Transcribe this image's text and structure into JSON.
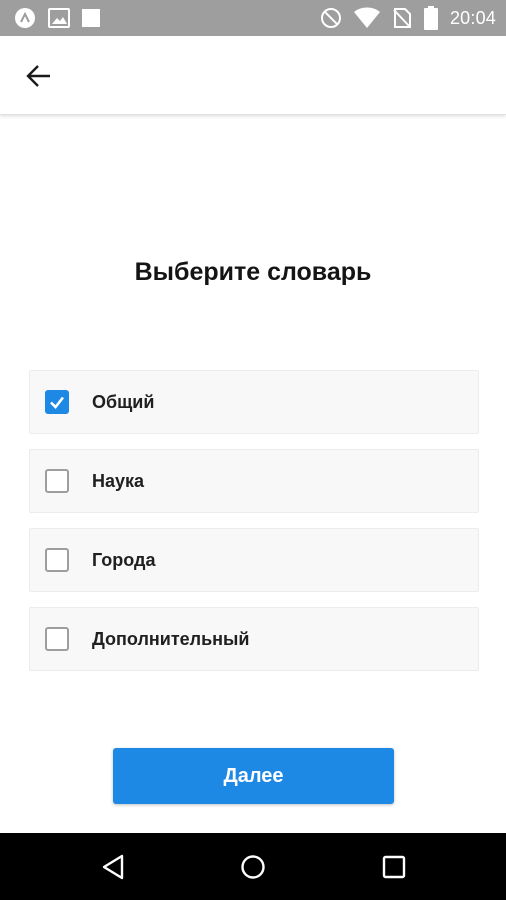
{
  "status_bar": {
    "time": "20:04",
    "left_icons": [
      "app-notification-icon",
      "image-notification-icon",
      "square-notification-icon"
    ],
    "right_icons": [
      "do-not-disturb-icon",
      "wifi-icon",
      "no-sim-icon",
      "battery-icon"
    ]
  },
  "app_bar": {
    "back_icon": "arrow-back-icon"
  },
  "title": "Выберите словарь",
  "options": [
    {
      "label": "Общий",
      "checked": true
    },
    {
      "label": "Наука",
      "checked": false
    },
    {
      "label": "Города",
      "checked": false
    },
    {
      "label": "Дополнительный",
      "checked": false
    }
  ],
  "next_button": {
    "label": "Далее"
  },
  "nav_bar": {
    "icons": [
      "nav-back-icon",
      "nav-home-icon",
      "nav-recents-icon"
    ]
  },
  "colors": {
    "accent": "#1e88e5",
    "status_bar": "#9e9e9e",
    "nav_bar": "#000000",
    "card_background": "#f8f8f8"
  }
}
